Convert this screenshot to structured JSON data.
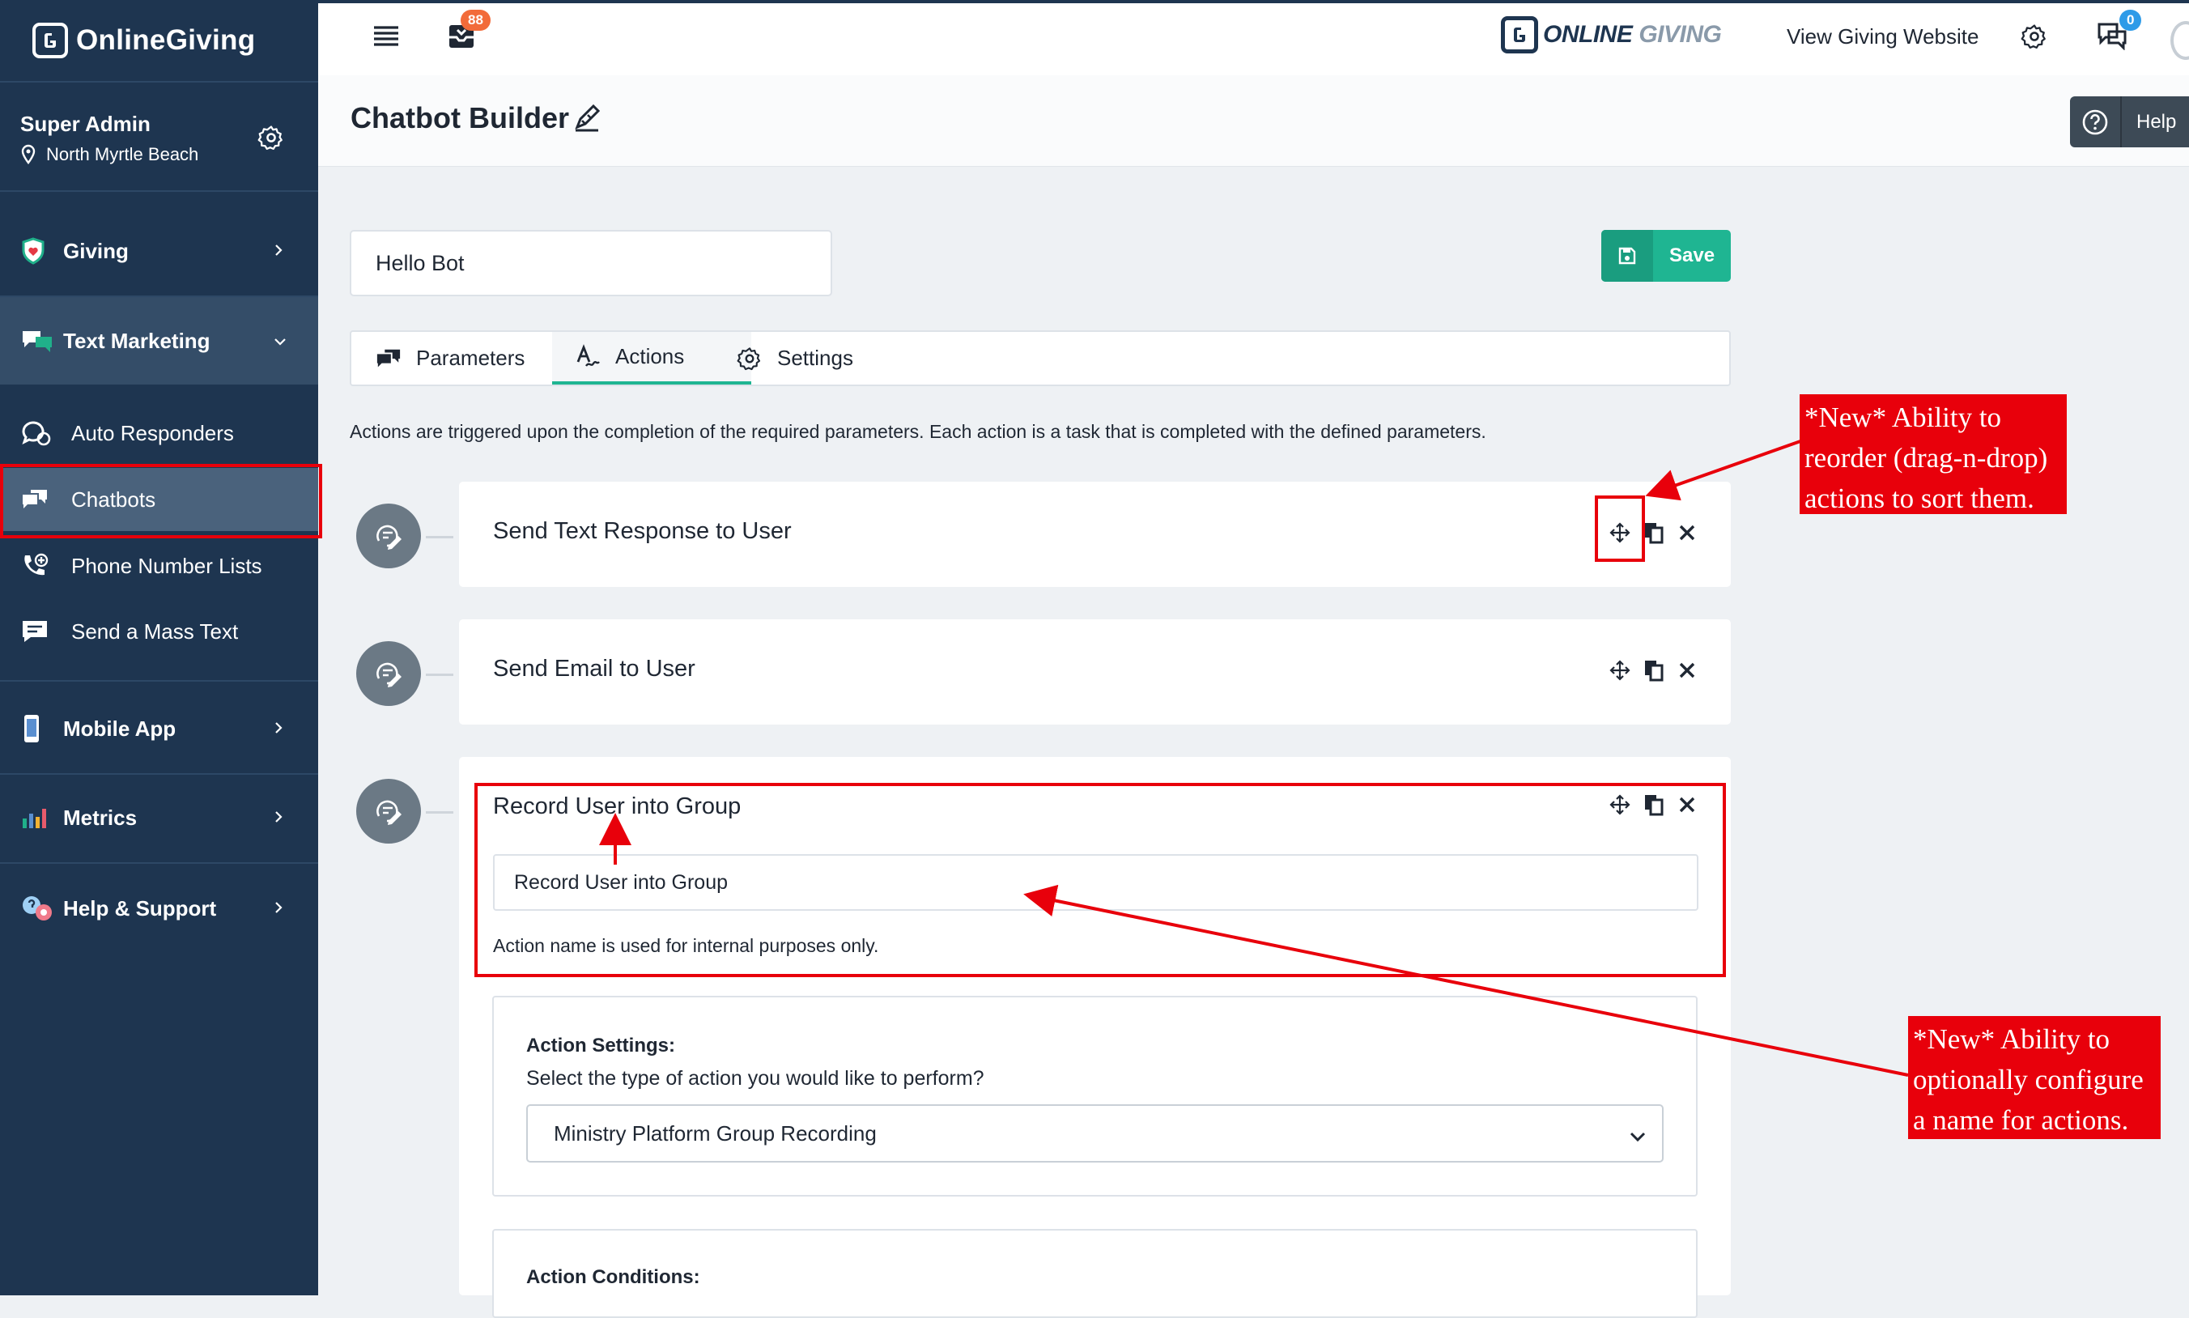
{
  "sidebar": {
    "brand": "OnlineGiving",
    "user_name": "Super Admin",
    "user_location": "North Myrtle Beach",
    "items": [
      {
        "label": "Giving",
        "icon": "shield-heart-icon"
      },
      {
        "label": "Text Marketing",
        "icon": "chat-bubbles-icon"
      },
      {
        "label": "Auto Responders",
        "icon": "chat-refresh-icon"
      },
      {
        "label": "Chatbots",
        "icon": "chat-bubbles-icon"
      },
      {
        "label": "Phone Number Lists",
        "icon": "phone-list-icon"
      },
      {
        "label": "Send a Mass Text",
        "icon": "message-icon"
      },
      {
        "label": "Mobile App",
        "icon": "mobile-icon"
      },
      {
        "label": "Metrics",
        "icon": "bar-chart-icon"
      },
      {
        "label": "Help & Support",
        "icon": "support-icon"
      }
    ]
  },
  "topbar": {
    "inbox_badge": "88",
    "logo_text_1": "ONLINE",
    "logo_text_2": "GIVING",
    "view_site": "View Giving Website",
    "chat_badge": "0"
  },
  "header": {
    "title": "Chatbot Builder",
    "help_label": "Help"
  },
  "builder": {
    "bot_name": "Hello Bot",
    "save_label": "Save",
    "tabs": [
      "Parameters",
      "Actions",
      "Settings"
    ],
    "description": "Actions are triggered upon the completion of the required parameters. Each action is a task that is completed with the defined parameters.",
    "actions": [
      {
        "title": "Send Text Response to User"
      },
      {
        "title": "Send Email to User"
      },
      {
        "title": "Record User into Group",
        "name_value": "Record User into Group",
        "hint": "Action name is used for internal purposes only."
      }
    ],
    "action_settings": {
      "title": "Action Settings:",
      "prompt": "Select the type of action you would like to perform?",
      "selected": "Ministry Platform Group Recording"
    },
    "action_conditions_title": "Action Conditions:"
  },
  "annotations": {
    "reorder": [
      "*New* Ability to",
      "reorder (drag-n-drop)",
      "actions to sort them."
    ],
    "naming": [
      "*New* Ability to",
      "optionally configure",
      "a name for actions."
    ]
  },
  "colors": {
    "sidebar": "#1e3550",
    "accent": "#1fb592",
    "badge": "#f26b3a",
    "annotation": "#e8000b"
  }
}
